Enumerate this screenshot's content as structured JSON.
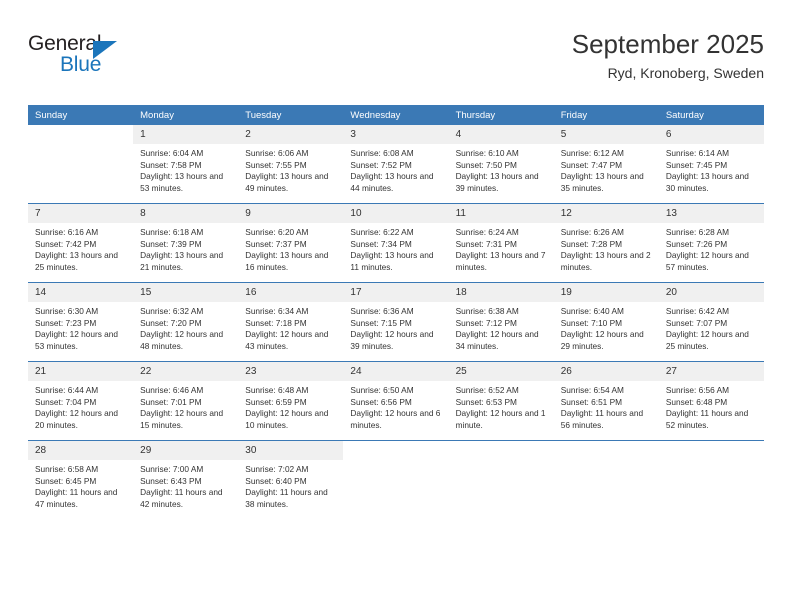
{
  "brand": {
    "name_part1": "General",
    "name_part2": "Blue",
    "accent_color": "#1b75bb",
    "triangle_icon": "triangle-logo-icon"
  },
  "header": {
    "title": "September 2025",
    "subtitle": "Ryd, Kronoberg, Sweden"
  },
  "calendar": {
    "header_bg": "#3b79b5",
    "daynum_bg": "#f0f0f0",
    "weekdays": [
      "Sunday",
      "Monday",
      "Tuesday",
      "Wednesday",
      "Thursday",
      "Friday",
      "Saturday"
    ],
    "weeks": [
      [
        {
          "day": "",
          "sunrise": "",
          "sunset": "",
          "daylight": ""
        },
        {
          "day": "1",
          "sunrise": "Sunrise: 6:04 AM",
          "sunset": "Sunset: 7:58 PM",
          "daylight": "Daylight: 13 hours and 53 minutes."
        },
        {
          "day": "2",
          "sunrise": "Sunrise: 6:06 AM",
          "sunset": "Sunset: 7:55 PM",
          "daylight": "Daylight: 13 hours and 49 minutes."
        },
        {
          "day": "3",
          "sunrise": "Sunrise: 6:08 AM",
          "sunset": "Sunset: 7:52 PM",
          "daylight": "Daylight: 13 hours and 44 minutes."
        },
        {
          "day": "4",
          "sunrise": "Sunrise: 6:10 AM",
          "sunset": "Sunset: 7:50 PM",
          "daylight": "Daylight: 13 hours and 39 minutes."
        },
        {
          "day": "5",
          "sunrise": "Sunrise: 6:12 AM",
          "sunset": "Sunset: 7:47 PM",
          "daylight": "Daylight: 13 hours and 35 minutes."
        },
        {
          "day": "6",
          "sunrise": "Sunrise: 6:14 AM",
          "sunset": "Sunset: 7:45 PM",
          "daylight": "Daylight: 13 hours and 30 minutes."
        }
      ],
      [
        {
          "day": "7",
          "sunrise": "Sunrise: 6:16 AM",
          "sunset": "Sunset: 7:42 PM",
          "daylight": "Daylight: 13 hours and 25 minutes."
        },
        {
          "day": "8",
          "sunrise": "Sunrise: 6:18 AM",
          "sunset": "Sunset: 7:39 PM",
          "daylight": "Daylight: 13 hours and 21 minutes."
        },
        {
          "day": "9",
          "sunrise": "Sunrise: 6:20 AM",
          "sunset": "Sunset: 7:37 PM",
          "daylight": "Daylight: 13 hours and 16 minutes."
        },
        {
          "day": "10",
          "sunrise": "Sunrise: 6:22 AM",
          "sunset": "Sunset: 7:34 PM",
          "daylight": "Daylight: 13 hours and 11 minutes."
        },
        {
          "day": "11",
          "sunrise": "Sunrise: 6:24 AM",
          "sunset": "Sunset: 7:31 PM",
          "daylight": "Daylight: 13 hours and 7 minutes."
        },
        {
          "day": "12",
          "sunrise": "Sunrise: 6:26 AM",
          "sunset": "Sunset: 7:28 PM",
          "daylight": "Daylight: 13 hours and 2 minutes."
        },
        {
          "day": "13",
          "sunrise": "Sunrise: 6:28 AM",
          "sunset": "Sunset: 7:26 PM",
          "daylight": "Daylight: 12 hours and 57 minutes."
        }
      ],
      [
        {
          "day": "14",
          "sunrise": "Sunrise: 6:30 AM",
          "sunset": "Sunset: 7:23 PM",
          "daylight": "Daylight: 12 hours and 53 minutes."
        },
        {
          "day": "15",
          "sunrise": "Sunrise: 6:32 AM",
          "sunset": "Sunset: 7:20 PM",
          "daylight": "Daylight: 12 hours and 48 minutes."
        },
        {
          "day": "16",
          "sunrise": "Sunrise: 6:34 AM",
          "sunset": "Sunset: 7:18 PM",
          "daylight": "Daylight: 12 hours and 43 minutes."
        },
        {
          "day": "17",
          "sunrise": "Sunrise: 6:36 AM",
          "sunset": "Sunset: 7:15 PM",
          "daylight": "Daylight: 12 hours and 39 minutes."
        },
        {
          "day": "18",
          "sunrise": "Sunrise: 6:38 AM",
          "sunset": "Sunset: 7:12 PM",
          "daylight": "Daylight: 12 hours and 34 minutes."
        },
        {
          "day": "19",
          "sunrise": "Sunrise: 6:40 AM",
          "sunset": "Sunset: 7:10 PM",
          "daylight": "Daylight: 12 hours and 29 minutes."
        },
        {
          "day": "20",
          "sunrise": "Sunrise: 6:42 AM",
          "sunset": "Sunset: 7:07 PM",
          "daylight": "Daylight: 12 hours and 25 minutes."
        }
      ],
      [
        {
          "day": "21",
          "sunrise": "Sunrise: 6:44 AM",
          "sunset": "Sunset: 7:04 PM",
          "daylight": "Daylight: 12 hours and 20 minutes."
        },
        {
          "day": "22",
          "sunrise": "Sunrise: 6:46 AM",
          "sunset": "Sunset: 7:01 PM",
          "daylight": "Daylight: 12 hours and 15 minutes."
        },
        {
          "day": "23",
          "sunrise": "Sunrise: 6:48 AM",
          "sunset": "Sunset: 6:59 PM",
          "daylight": "Daylight: 12 hours and 10 minutes."
        },
        {
          "day": "24",
          "sunrise": "Sunrise: 6:50 AM",
          "sunset": "Sunset: 6:56 PM",
          "daylight": "Daylight: 12 hours and 6 minutes."
        },
        {
          "day": "25",
          "sunrise": "Sunrise: 6:52 AM",
          "sunset": "Sunset: 6:53 PM",
          "daylight": "Daylight: 12 hours and 1 minute."
        },
        {
          "day": "26",
          "sunrise": "Sunrise: 6:54 AM",
          "sunset": "Sunset: 6:51 PM",
          "daylight": "Daylight: 11 hours and 56 minutes."
        },
        {
          "day": "27",
          "sunrise": "Sunrise: 6:56 AM",
          "sunset": "Sunset: 6:48 PM",
          "daylight": "Daylight: 11 hours and 52 minutes."
        }
      ],
      [
        {
          "day": "28",
          "sunrise": "Sunrise: 6:58 AM",
          "sunset": "Sunset: 6:45 PM",
          "daylight": "Daylight: 11 hours and 47 minutes."
        },
        {
          "day": "29",
          "sunrise": "Sunrise: 7:00 AM",
          "sunset": "Sunset: 6:43 PM",
          "daylight": "Daylight: 11 hours and 42 minutes."
        },
        {
          "day": "30",
          "sunrise": "Sunrise: 7:02 AM",
          "sunset": "Sunset: 6:40 PM",
          "daylight": "Daylight: 11 hours and 38 minutes."
        },
        {
          "day": "",
          "sunrise": "",
          "sunset": "",
          "daylight": ""
        },
        {
          "day": "",
          "sunrise": "",
          "sunset": "",
          "daylight": ""
        },
        {
          "day": "",
          "sunrise": "",
          "sunset": "",
          "daylight": ""
        },
        {
          "day": "",
          "sunrise": "",
          "sunset": "",
          "daylight": ""
        }
      ]
    ]
  }
}
